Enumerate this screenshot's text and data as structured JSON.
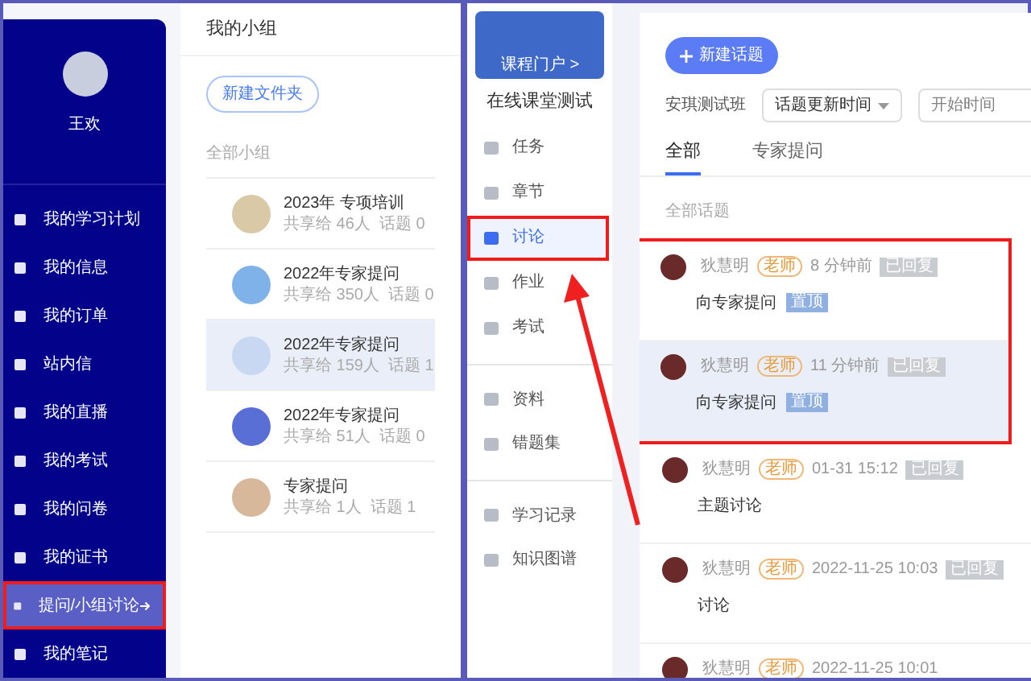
{
  "profile": {
    "name": "王欢"
  },
  "side_menu": [
    {
      "label": "我的学习计划",
      "selected": false
    },
    {
      "label": "我的信息",
      "selected": false
    },
    {
      "label": "我的订单",
      "selected": false
    },
    {
      "label": "站内信",
      "selected": false
    },
    {
      "label": "我的直播",
      "selected": false
    },
    {
      "label": "我的考试",
      "selected": false
    },
    {
      "label": "我的问卷",
      "selected": false
    },
    {
      "label": "我的证书",
      "selected": false
    },
    {
      "label": "提问/小组讨论",
      "selected": true
    },
    {
      "label": "我的笔记",
      "selected": false
    }
  ],
  "groups_panel": {
    "title": "我的小组",
    "new_folder_button": "新建文件夹",
    "section_label": "全部小组",
    "groups": [
      {
        "name": "2023年 专项培训",
        "meta": "共享给 46人  话题 0",
        "selected": false
      },
      {
        "name": "2022年专家提问",
        "meta": "共享给 350人  话题 0",
        "selected": false
      },
      {
        "name": "2022年专家提问",
        "meta": "共享给 159人  话题 1",
        "selected": true
      },
      {
        "name": "2022年专家提问",
        "meta": "共享给 51人  话题 0",
        "selected": false
      },
      {
        "name": "专家提问",
        "meta": "共享给 1人  话题 1",
        "selected": false
      }
    ]
  },
  "course": {
    "banner_link": "课程门户 >",
    "title": "在线课堂测试",
    "nav": [
      {
        "label": "任务",
        "selected": false,
        "divider_before": false
      },
      {
        "label": "章节",
        "selected": false,
        "divider_before": false
      },
      {
        "label": "讨论",
        "selected": true,
        "divider_before": false
      },
      {
        "label": "作业",
        "selected": false,
        "divider_before": false
      },
      {
        "label": "考试",
        "selected": false,
        "divider_before": false
      },
      {
        "label": "资料",
        "selected": false,
        "divider_before": true
      },
      {
        "label": "错题集",
        "selected": false,
        "divider_before": false
      },
      {
        "label": "学习记录",
        "selected": false,
        "divider_before": true
      },
      {
        "label": "知识图谱",
        "selected": false,
        "divider_before": false
      }
    ]
  },
  "discussion": {
    "new_topic_button": "新建话题",
    "class_name": "安琪测试班",
    "sort_select": "话题更新时间",
    "date_field": {
      "placeholder": "开始时间"
    },
    "tabs": [
      {
        "label": "全部",
        "selected": true
      },
      {
        "label": "专家提问",
        "selected": false
      }
    ],
    "section_label": "全部话题",
    "posts": [
      {
        "author": "狄慧明",
        "role": "老师",
        "time": "8 分钟前",
        "status": "已回复",
        "title": "向专家提问",
        "pinned_label": "置顶",
        "highlighted": false
      },
      {
        "author": "狄慧明",
        "role": "老师",
        "time": "11 分钟前",
        "status": "已回复",
        "title": "向专家提问",
        "pinned_label": "置顶",
        "highlighted": true
      },
      {
        "author": "狄慧明",
        "role": "老师",
        "time": "01-31 15:12",
        "status": "已回复",
        "title": "主题讨论",
        "highlighted": false
      },
      {
        "author": "狄慧明",
        "role": "老师",
        "time": "2022-11-25 10:03",
        "status": "已回复",
        "title": "讨论",
        "highlighted": false
      },
      {
        "author": "狄慧明",
        "role": "老师",
        "time": "2022-11-25 10:01",
        "highlighted": false
      }
    ]
  }
}
